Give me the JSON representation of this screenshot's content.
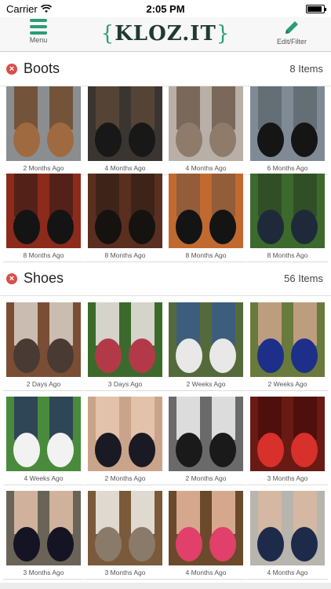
{
  "status_bar": {
    "carrier": "Carrier",
    "time": "2:05 PM",
    "battery_level": 0.9
  },
  "nav": {
    "menu_label": "Menu",
    "logo": "KLOZ.IT",
    "edit_label": "Edit/Filter"
  },
  "sections": [
    {
      "title": "Boots",
      "count": "8 Items",
      "items": [
        {
          "caption": "2 Months Ago",
          "colors": [
            "#8a8e90",
            "#a06a40",
            "#6f4a2b"
          ]
        },
        {
          "caption": "4 Months Ago",
          "colors": [
            "#3a3530",
            "#181818",
            "#5a4636"
          ]
        },
        {
          "caption": "4 Months Ago",
          "colors": [
            "#b8b0a6",
            "#8f7b6a",
            "#6e5c4e"
          ]
        },
        {
          "caption": "6 Months Ago",
          "colors": [
            "#7f8a94",
            "#151515",
            "#5e6870"
          ]
        },
        {
          "caption": "8 Months Ago",
          "colors": [
            "#8c2a1c",
            "#141414",
            "#4a2018"
          ]
        },
        {
          "caption": "8 Months Ago",
          "colors": [
            "#5a2f20",
            "#161210",
            "#3a2218"
          ]
        },
        {
          "caption": "8 Months Ago",
          "colors": [
            "#c06a30",
            "#141414",
            "#8a5a3a"
          ]
        },
        {
          "caption": "8 Months Ago",
          "colors": [
            "#3c6a2c",
            "#1e2a3a",
            "#2f4a26"
          ]
        }
      ]
    },
    {
      "title": "Shoes",
      "count": "56 Items",
      "items": [
        {
          "caption": "2 Days Ago",
          "colors": [
            "#7a4e34",
            "#4a3a34",
            "#d8d0c8"
          ]
        },
        {
          "caption": "3 Days Ago",
          "colors": [
            "#3c6a2c",
            "#b23a48",
            "#f0e6e6"
          ]
        },
        {
          "caption": "2 Weeks Ago",
          "colors": [
            "#556a3a",
            "#e8e8e8",
            "#3a5a8a"
          ]
        },
        {
          "caption": "2 Weeks Ago",
          "colors": [
            "#6a7a3c",
            "#1e2f8a",
            "#caa58a"
          ]
        },
        {
          "caption": "4 Weeks Ago",
          "colors": [
            "#4a8a3c",
            "#f2f2f2",
            "#2a3a5a"
          ]
        },
        {
          "caption": "2 Months Ago",
          "colors": [
            "#caa48a",
            "#1a1a24",
            "#e8c8b0"
          ]
        },
        {
          "caption": "2 Months Ago",
          "colors": [
            "#6a6a6a",
            "#1a1a1a",
            "#f0f0f0"
          ]
        },
        {
          "caption": "3 Months Ago",
          "colors": [
            "#6a1a14",
            "#d8302a",
            "#4a0e0a"
          ]
        },
        {
          "caption": "3 Months Ago",
          "colors": [
            "#6a6458",
            "#141424",
            "#e2c0a8"
          ]
        },
        {
          "caption": "3 Months Ago",
          "colors": [
            "#7a5a3a",
            "#8a7a6a",
            "#f2f0ea"
          ]
        },
        {
          "caption": "4 Months Ago",
          "colors": [
            "#6a4a2a",
            "#e0406a",
            "#e8b8a0"
          ]
        },
        {
          "caption": "4 Months Ago",
          "colors": [
            "#b8b4ae",
            "#1e2a4a",
            "#d8b8a0"
          ]
        }
      ]
    }
  ]
}
